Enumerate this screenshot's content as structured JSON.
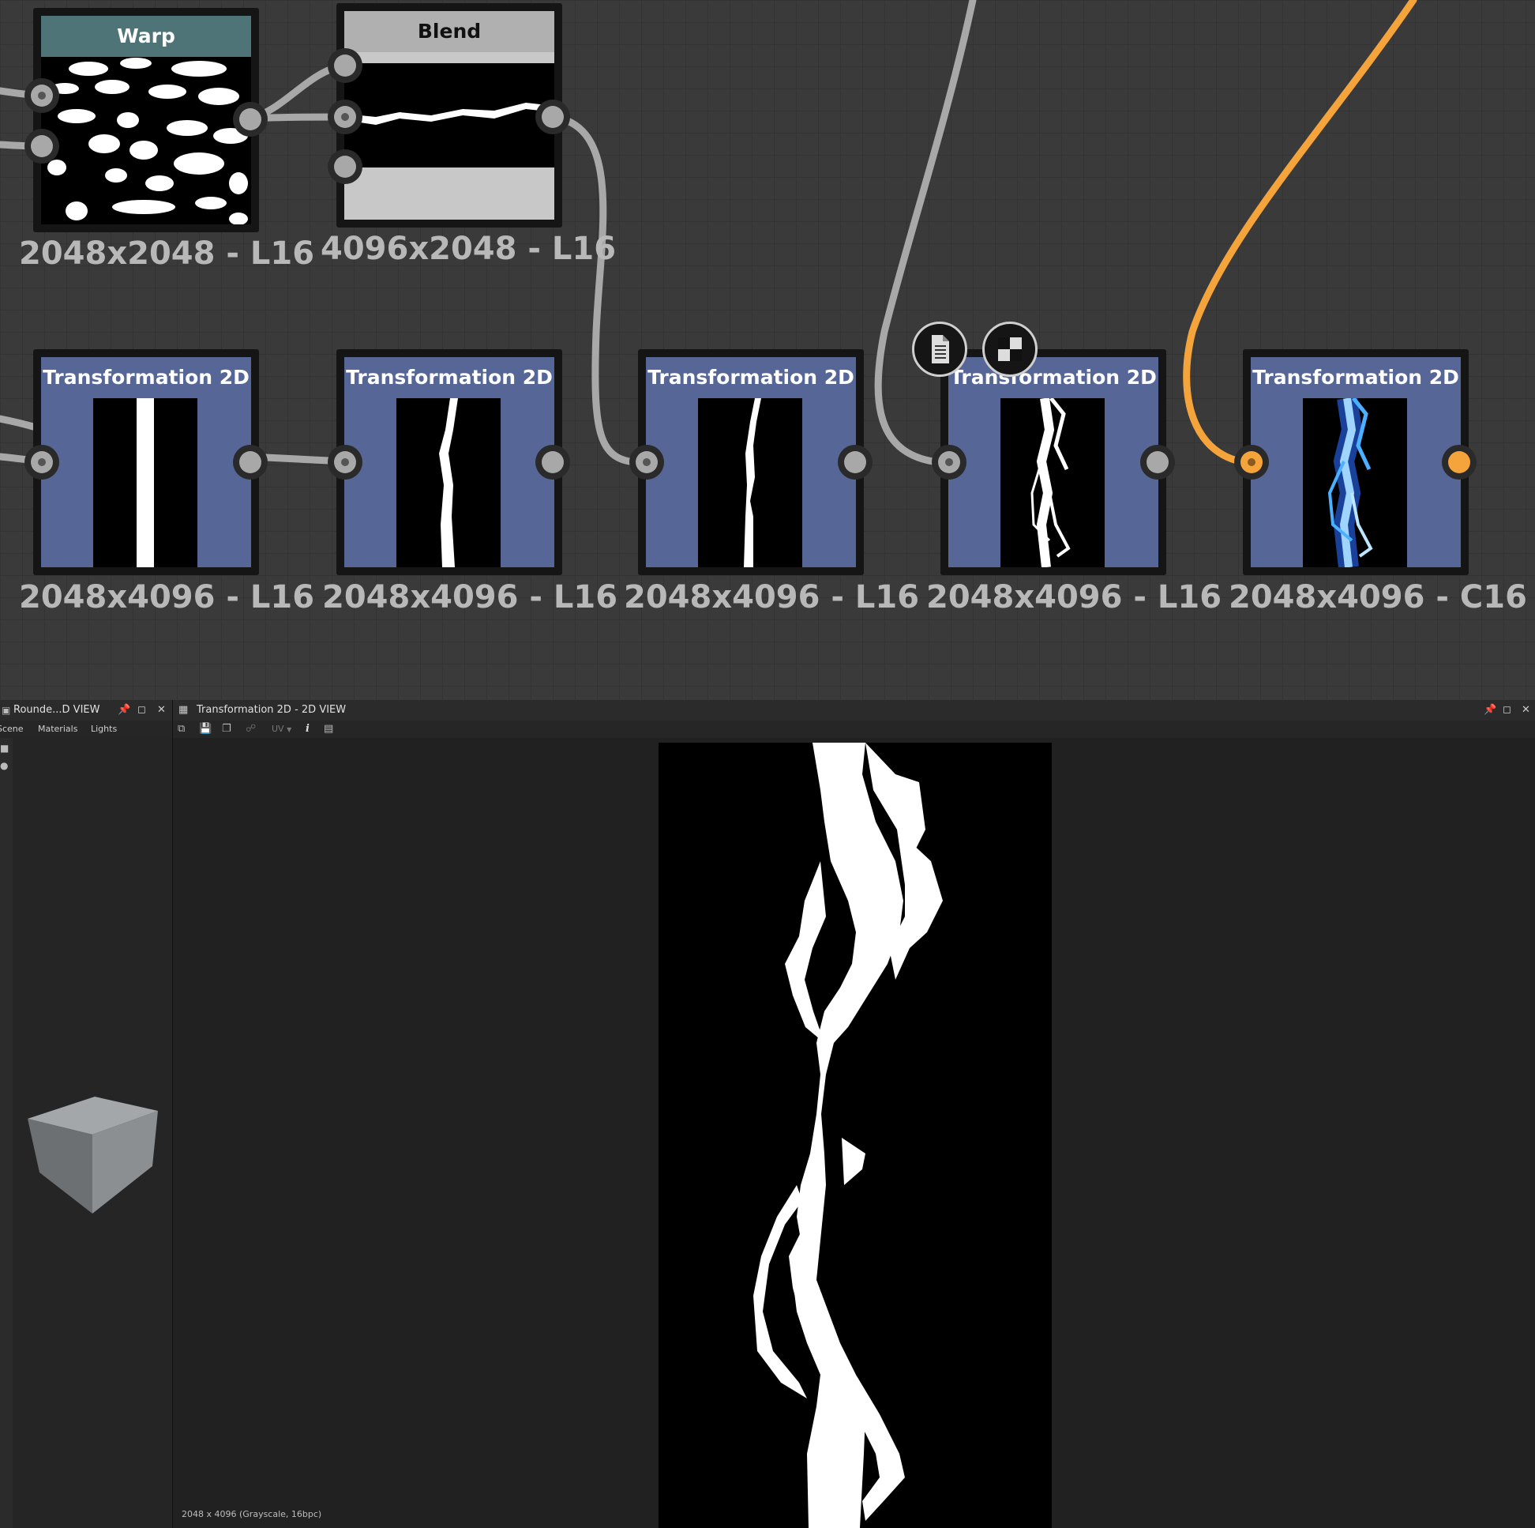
{
  "graph": {
    "nodes": [
      {
        "title": "Warp",
        "size": "2048x2048 - L16"
      },
      {
        "title": "Blend",
        "size": "4096x2048 - L16"
      },
      {
        "title": "Transformation 2D",
        "size": "2048x4096 - L16"
      },
      {
        "title": "Transformation 2D",
        "size": "2048x4096 - L16"
      },
      {
        "title": "Transformation 2D",
        "size": "2048x4096 - L16"
      },
      {
        "title": "Transformation 2D",
        "size": "2048x4096 - L16"
      },
      {
        "title": "Transformation 2D",
        "size": "2048x4096 - C16"
      }
    ],
    "colors": {
      "warp_header": "#4f7478",
      "blend_header": "#b0b0b0",
      "transform_header": "#566696",
      "orange_link": "#f4a43a",
      "gray_link": "#a8a8a8"
    }
  },
  "scene_panel": {
    "title": "Rounde...D VIEW",
    "tabs": [
      "Scene",
      "Materials",
      "Lights"
    ]
  },
  "view2d": {
    "title": "Transformation 2D - 2D VIEW",
    "uv_label": "UV",
    "info_label": "i",
    "status": "2048 x 4096 (Grayscale, 16bpc)"
  }
}
